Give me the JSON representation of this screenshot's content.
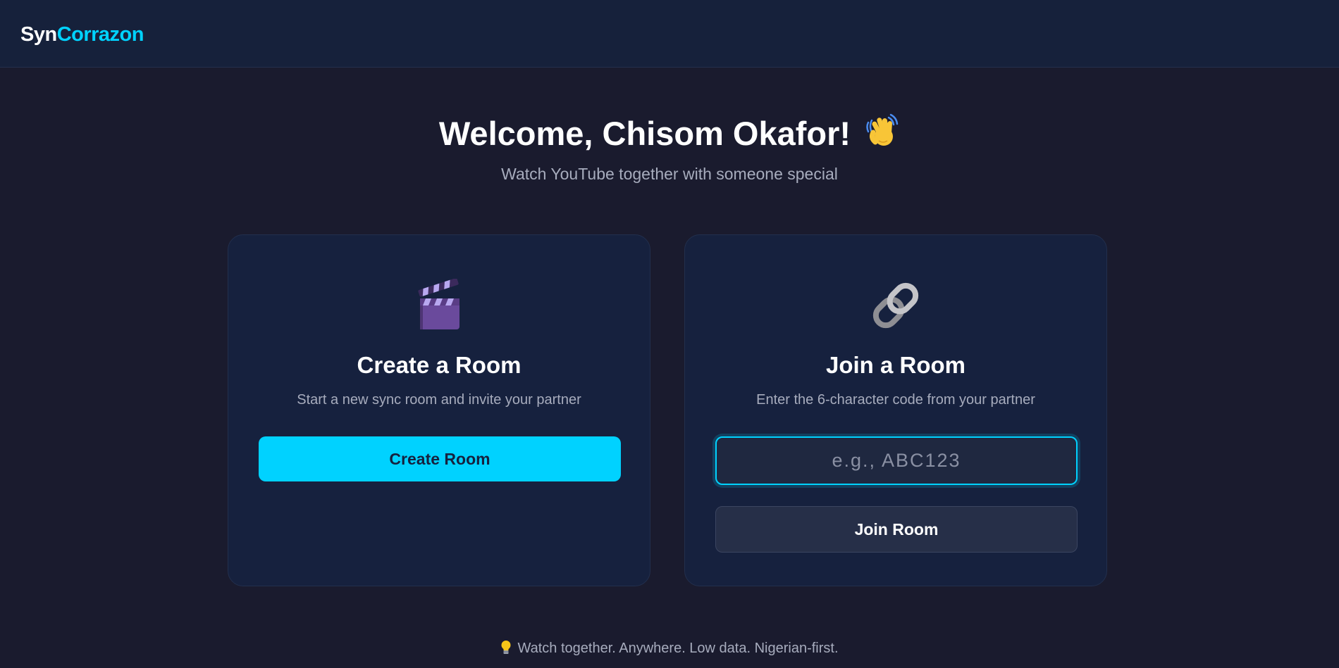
{
  "header": {
    "logo_part1": "Syn",
    "logo_part2": "Corrazon"
  },
  "welcome": {
    "title": "Welcome, Chisom Okafor!",
    "subtitle": "Watch YouTube together with someone special",
    "icon": "waving-hand-icon"
  },
  "create_card": {
    "icon": "clapperboard-icon",
    "title": "Create a Room",
    "description": "Start a new sync room and invite your partner",
    "button_label": "Create Room"
  },
  "join_card": {
    "icon": "link-icon",
    "title": "Join a Room",
    "description": "Enter the 6-character code from your partner",
    "input_placeholder": "e.g., ABC123",
    "input_value": "",
    "button_label": "Join Room"
  },
  "footer": {
    "icon": "lightbulb-icon",
    "text": "Watch together. Anywhere. Low data. Nigerian-first."
  },
  "colors": {
    "background": "#1a1b2e",
    "header_bg": "#16213b",
    "card_bg": "#16213e",
    "accent": "#00d2ff",
    "muted_text": "#a7acbd"
  }
}
